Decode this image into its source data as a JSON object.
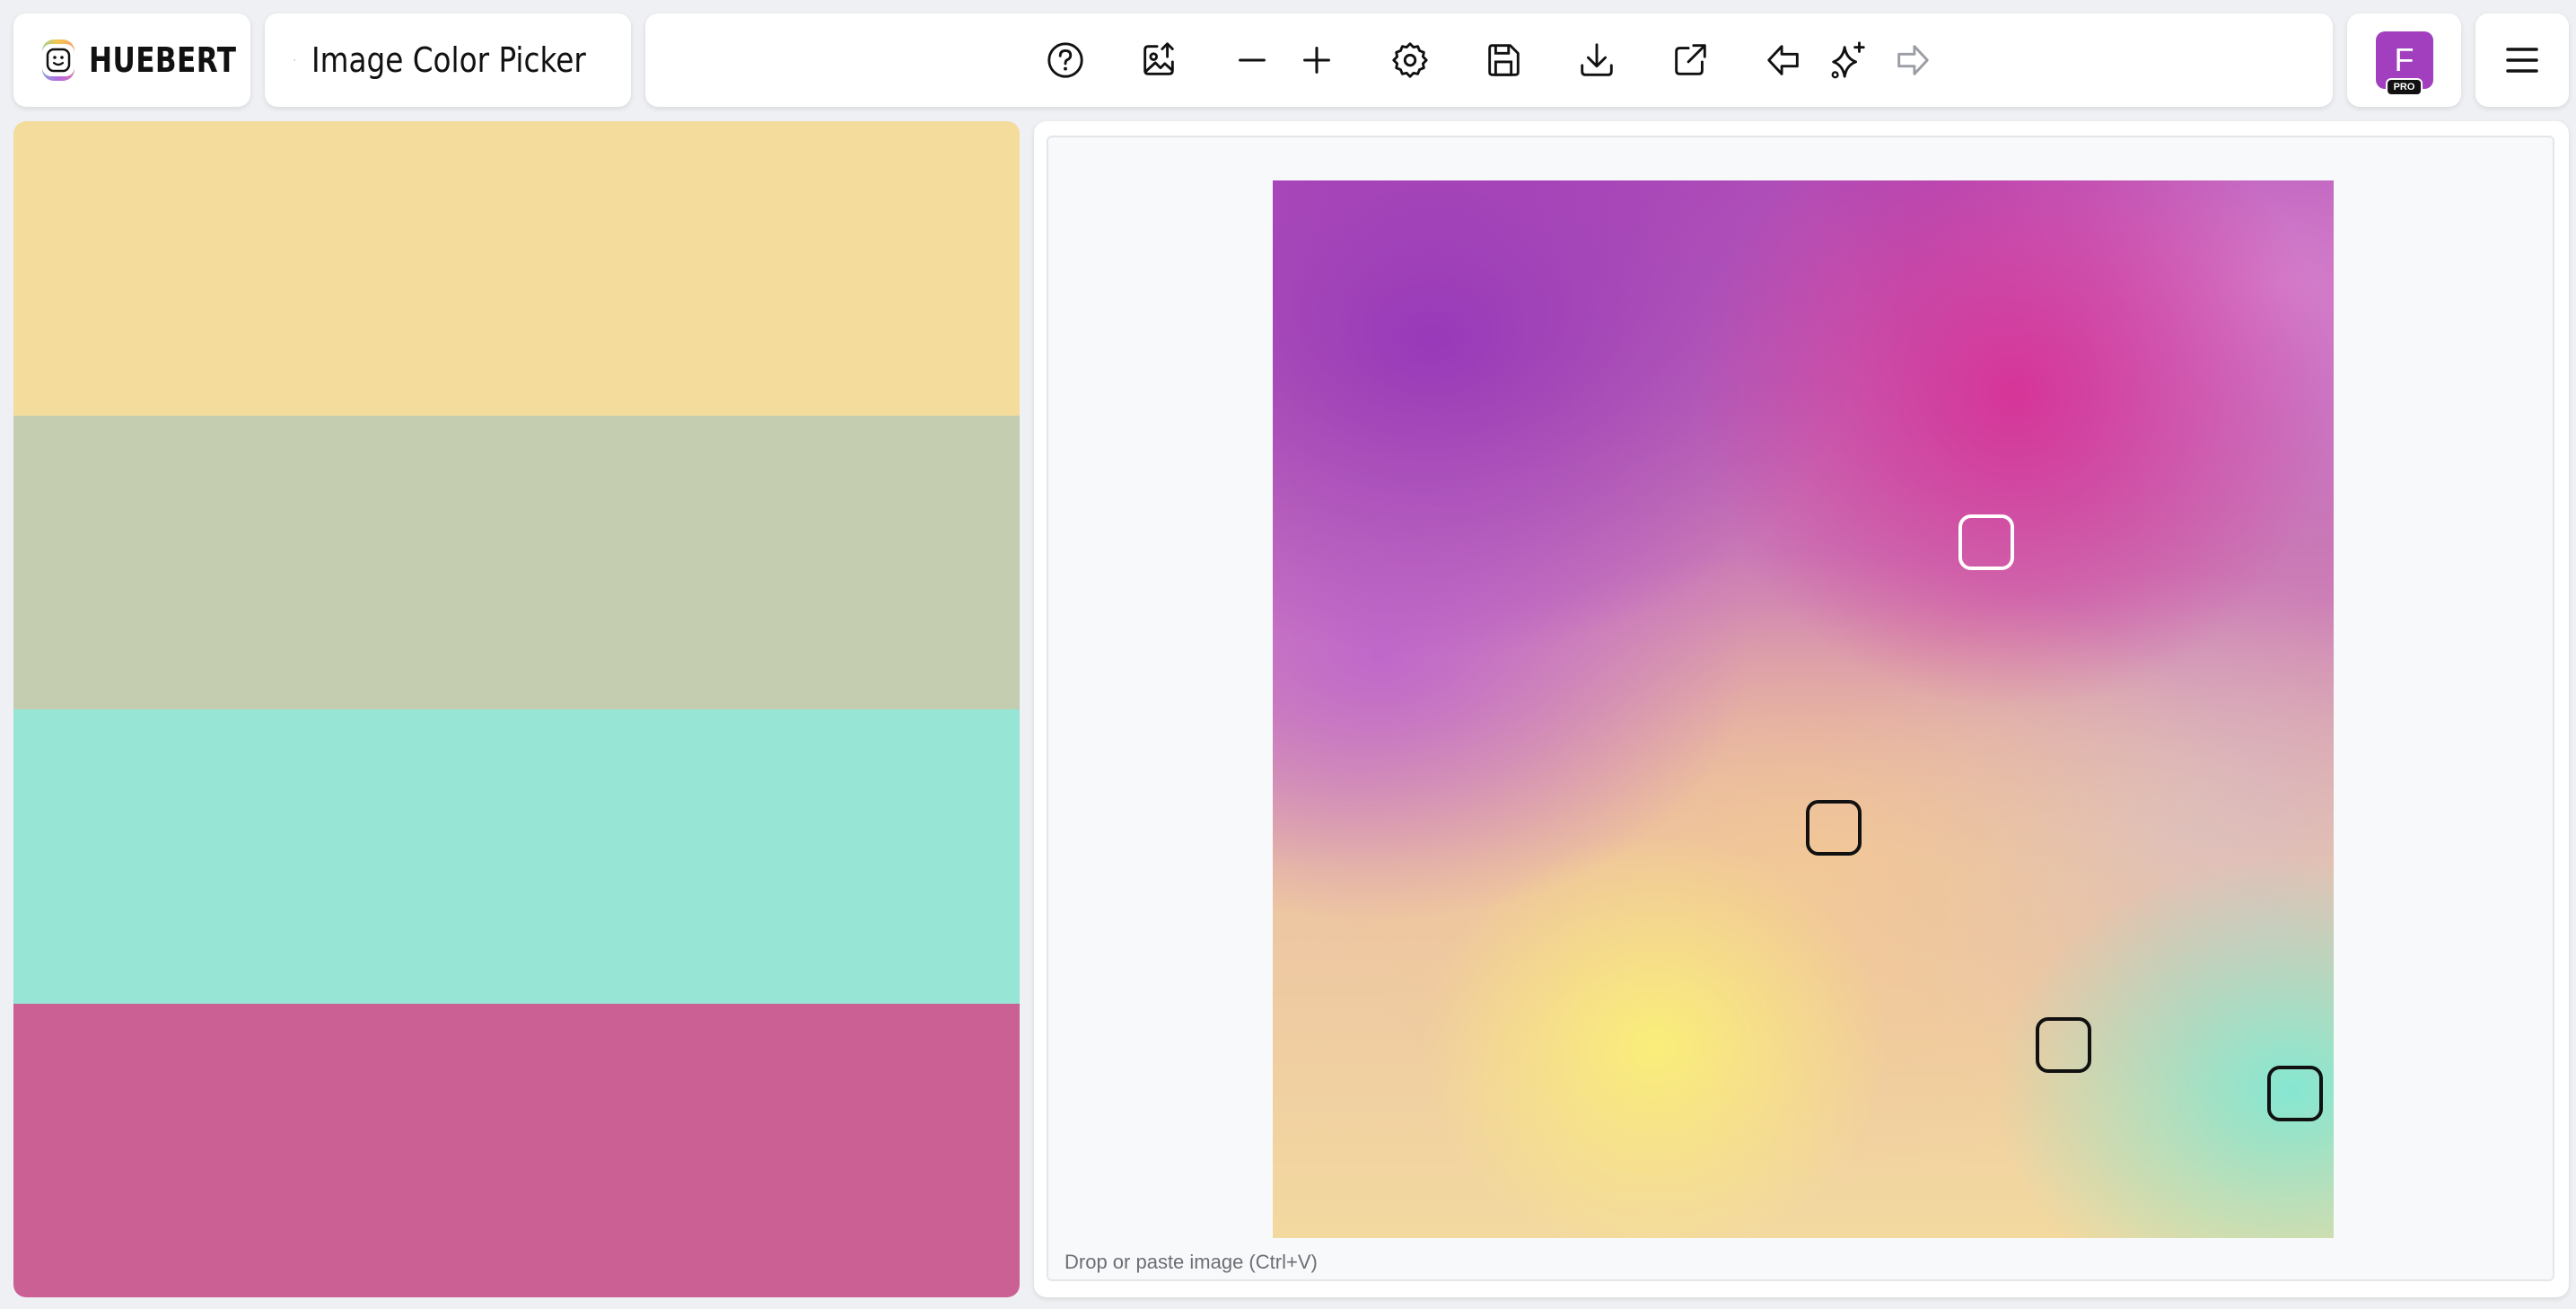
{
  "app": {
    "brand": "HUEBERT",
    "tool_name": "Image Color Picker"
  },
  "toolbar": {
    "buttons": [
      {
        "name": "help",
        "icon": "question-circle-icon"
      },
      {
        "name": "upload-image",
        "icon": "image-upload-icon"
      },
      {
        "name": "remove-color",
        "icon": "minus-icon"
      },
      {
        "name": "add-color",
        "icon": "plus-icon"
      },
      {
        "name": "settings",
        "icon": "gear-icon"
      },
      {
        "name": "save",
        "icon": "floppy-disk-icon"
      },
      {
        "name": "download",
        "icon": "download-icon"
      },
      {
        "name": "open-external",
        "icon": "external-link-icon"
      },
      {
        "name": "undo",
        "icon": "arrow-left-icon"
      },
      {
        "name": "magic",
        "icon": "sparkles-icon"
      },
      {
        "name": "redo",
        "icon": "arrow-right-icon"
      }
    ]
  },
  "user": {
    "initial": "F",
    "badge": "PRO"
  },
  "palette": {
    "colors": [
      "#f3dc9c",
      "#c5cdb0",
      "#96e5d5",
      "#cb6095"
    ]
  },
  "preview": {
    "hint": "Drop or paste image (Ctrl+V)"
  },
  "colors": {
    "background": "#eef0f3",
    "avatar": "#a23fbf",
    "marker_dark": "#111111",
    "marker_light": "#ffffff"
  }
}
